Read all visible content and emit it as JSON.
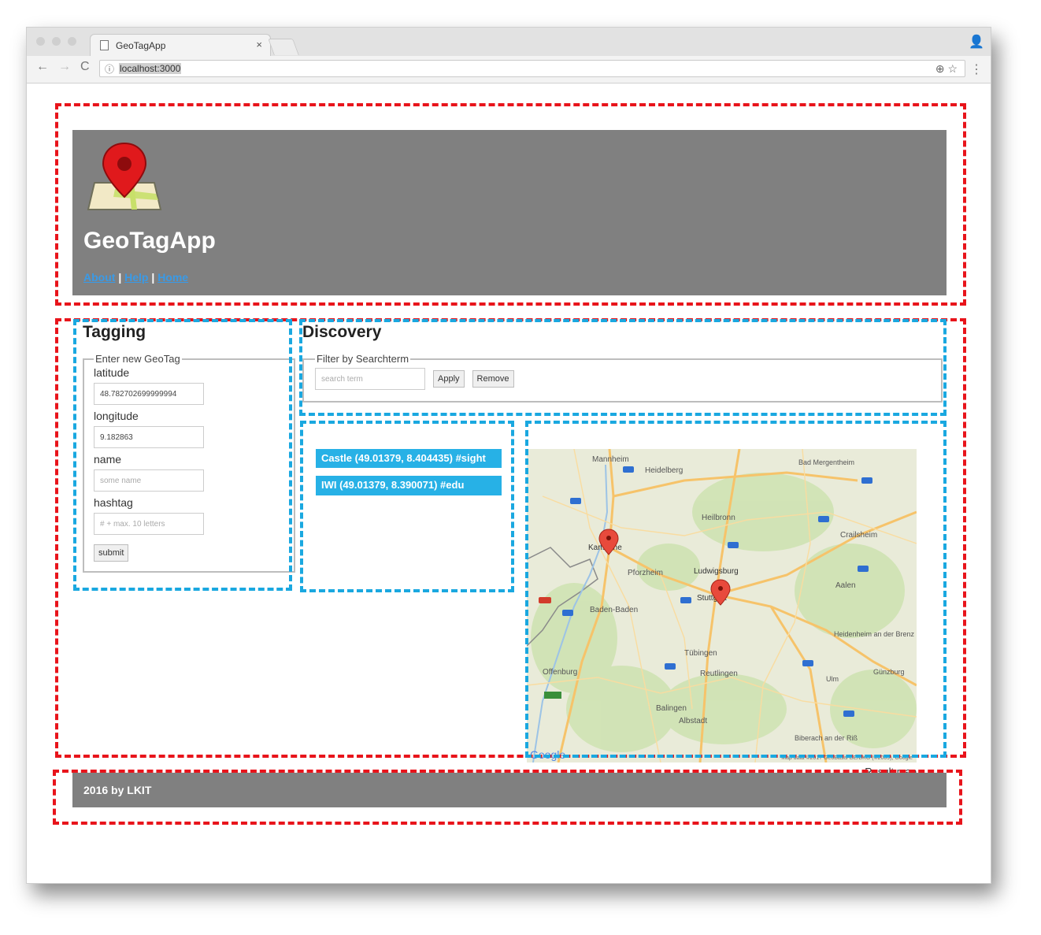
{
  "browser": {
    "tab_title": "GeoTagApp",
    "tab_close": "×",
    "url": "localhost:3000",
    "back": "←",
    "forward": "→",
    "reload": "C",
    "info_icon": "ⓘ",
    "omnibox_icons": "⊕  ☆",
    "menu": "⋮",
    "profile": "👤"
  },
  "header": {
    "title": "GeoTagApp",
    "nav": {
      "about": "About",
      "sep1": " | ",
      "help": "Help",
      "sep2": " | ",
      "home": "Home"
    }
  },
  "tagging": {
    "heading": "Tagging",
    "legend": "Enter new GeoTag",
    "latitude_label": "latitude",
    "latitude_value": "48.782702699999994",
    "longitude_label": "longitude",
    "longitude_value": "9.182863",
    "name_label": "name",
    "name_placeholder": "some name",
    "hashtag_label": "hashtag",
    "hashtag_placeholder": "# + max. 10 letters",
    "submit": "submit"
  },
  "discovery": {
    "heading": "Discovery",
    "legend": "Filter by Searchterm",
    "search_placeholder": "search term",
    "apply": "Apply",
    "remove": "Remove",
    "results": [
      "Castle (49.01379, 8.404435) #sight",
      "IWI (49.01379, 8.390071) #edu"
    ]
  },
  "map": {
    "caption": "Result map",
    "attribution": "Map data ©2017 GeoBasis-DE/BKG (©2009), Google",
    "google": "Google",
    "places": [
      "Mannheim",
      "Heidelberg",
      "Bad Mergentheim",
      "Heilbronn",
      "Crailsheim",
      "Karlsruhe",
      "Pforzheim",
      "Ludwigsburg",
      "Stuttgart",
      "Aalen",
      "Baden-Baden",
      "Heidenheim an der Brenz",
      "Tübingen",
      "Reutlingen",
      "Offenburg",
      "Günzburg",
      "Ulm",
      "Balingen",
      "Albstadt",
      "Biberach an der Riß"
    ]
  },
  "footer": {
    "text": "2016 by LKIT"
  },
  "colors": {
    "header_bg": "#808080",
    "result_bg": "#27b1e6",
    "link": "#3a9ae6",
    "annotation_red": "#e8141b",
    "annotation_blue": "#1aa8e0"
  }
}
